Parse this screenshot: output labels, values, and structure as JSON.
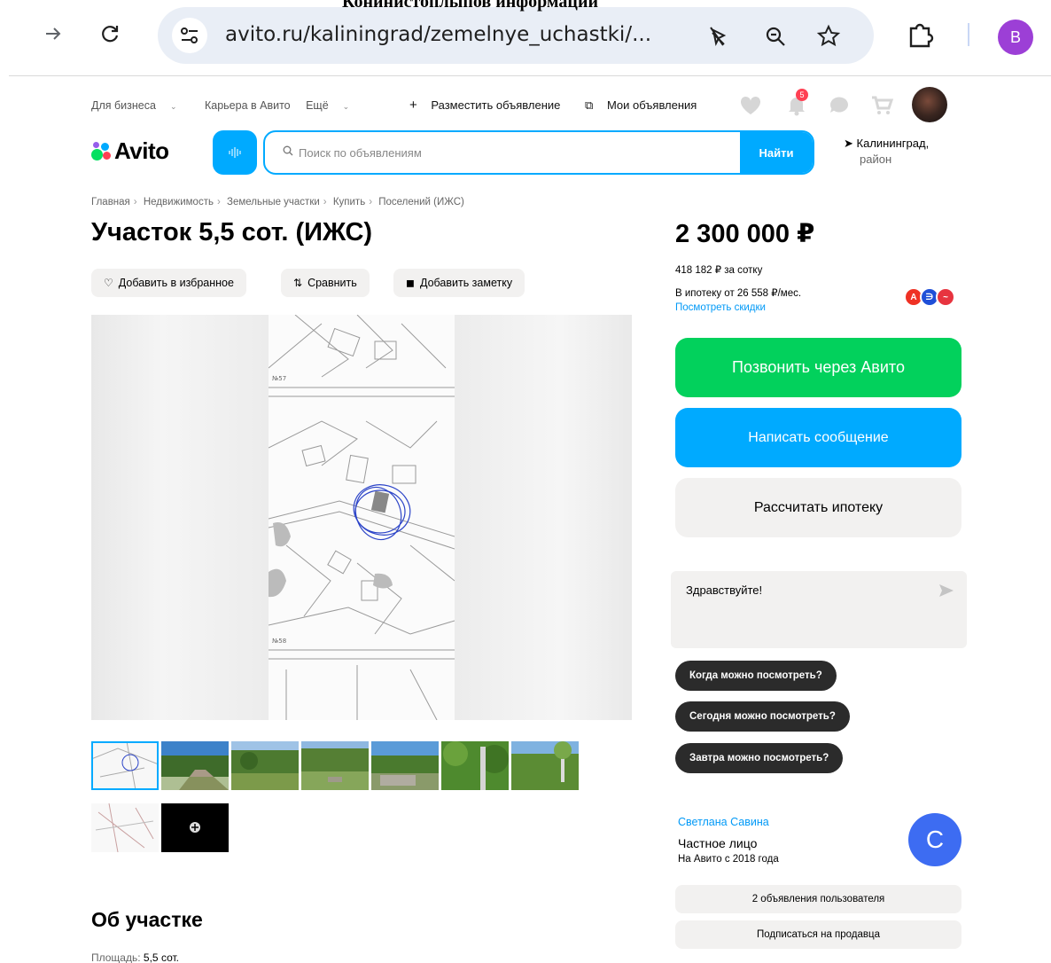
{
  "browser": {
    "caption": "Конинистоплыпов информации",
    "url": "avito.ru/kaliningrad/zemelnye_uchastki/...",
    "profile_letter": "B"
  },
  "header": {
    "top_links": [
      "Для бизнеса",
      "Карьера в Авито",
      "Ещё"
    ],
    "post_ad": "Разместить объявление",
    "my_ads": "Мои объявления",
    "notification_count": "5",
    "logo_text": "Avito",
    "search_placeholder": "Поиск по объявлениям",
    "search_button": "Найти",
    "location_city": "Калининград,",
    "location_sub": "район"
  },
  "listing": {
    "breadcrumb": [
      "Главная",
      "Недвижимость",
      "Земельные участки",
      "Купить",
      "Поселений (ИЖС)"
    ],
    "title": "Участок 5,5 сот. (ИЖС)",
    "actions": {
      "favorite": "Добавить в избранное",
      "compare": "Сравнить",
      "note": "Добавить заметку"
    },
    "map_labels": [
      "№57",
      "№58"
    ],
    "about_title": "Об участке",
    "area_label": "Площадь:",
    "area_value": "5,5 сот."
  },
  "sidebar": {
    "price": "2 300 000 ₽",
    "price_per": "418 182 ₽ за сотку",
    "mortgage": "В ипотеку от 26 558 ₽/мес.",
    "discounts_link": "Посмотреть скидки",
    "call_button": "Позвонить через Авито",
    "message_button": "Написать сообщение",
    "mortgage_button": "Рассчитать ипотеку",
    "chat_greeting": "Здравствуйте!",
    "quick_replies": [
      "Когда можно посмотреть?",
      "Сегодня можно посмотреть?",
      "Завтра можно посмотреть?"
    ],
    "seller": {
      "name": "Светлана Савина",
      "type": "Частное лицо",
      "since": "На Авито с 2018 года",
      "avatar_letter": "С"
    },
    "user_ads_button": "2 объявления пользователя",
    "subscribe_button": "Подписаться на продавца"
  },
  "colors": {
    "avito_blue": "#00aaff",
    "call_green": "#02d15c",
    "chip_bg": "#f2f1f0",
    "link_blue": "#0099f7"
  }
}
